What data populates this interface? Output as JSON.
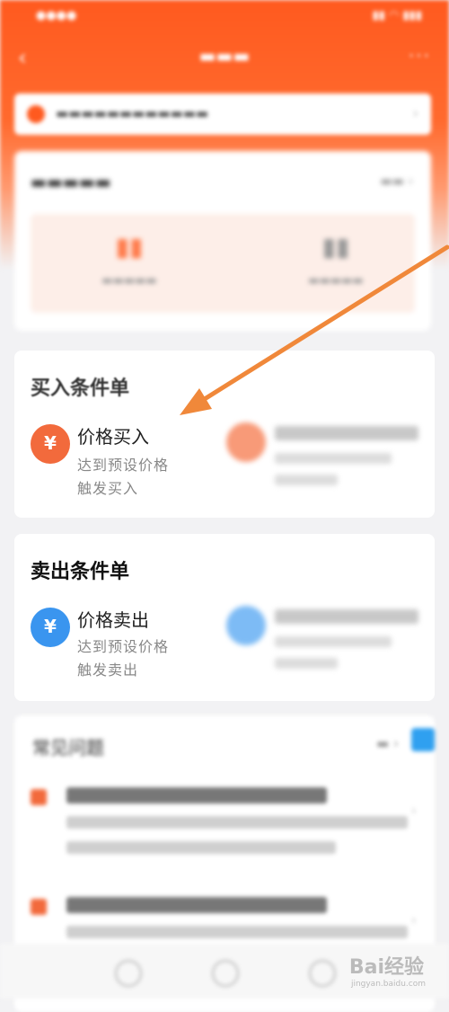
{
  "buy_section": {
    "title": "买入条件单",
    "price_option": {
      "icon": "yen-icon",
      "title": "价格买入",
      "desc_line1": "达到预设价格",
      "desc_line2": "触发买入"
    }
  },
  "sell_section": {
    "title": "卖出条件单",
    "price_option": {
      "icon": "yen-icon",
      "title": "价格卖出",
      "desc_line1": "达到预设价格",
      "desc_line2": "触发卖出"
    }
  },
  "faq": {
    "title": "常见问题"
  },
  "watermark": {
    "text": "Bai经验",
    "sub": "jingyan.baidu.com"
  },
  "colors": {
    "brand_orange": "#ff5a1f",
    "buy_icon": "#f26a3c",
    "sell_icon": "#3a95ef",
    "annotation_arrow": "#f0883a"
  }
}
